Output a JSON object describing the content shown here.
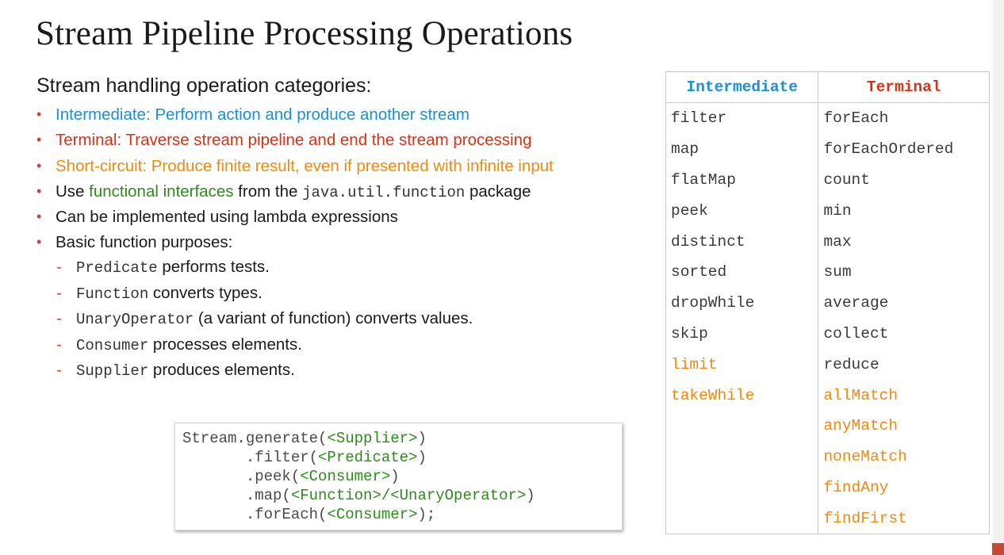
{
  "title": "Stream Pipeline Processing Operations",
  "subtitle": "Stream handling operation categories:",
  "bullets": {
    "intermediate": "Intermediate: Perform action and produce another stream",
    "terminal": "Terminal: Traverse stream pipeline and end the stream processing",
    "short_circuit": "Short-circuit: Produce finite result, even if presented with infinite input",
    "functional_prefix": "Use ",
    "functional_highlight": "functional interfaces",
    "functional_mid": " from the ",
    "functional_code": "java.util.function",
    "functional_suffix": " package",
    "lambda": "Can be implemented using lambda expressions",
    "purposes": "Basic function purposes:"
  },
  "purposes": [
    {
      "code": "Predicate",
      "text": " performs tests."
    },
    {
      "code": "Function",
      "text": " converts types."
    },
    {
      "code": "UnaryOperator",
      "text": " (a variant of function) converts values."
    },
    {
      "code": "Consumer",
      "text": " processes elements."
    },
    {
      "code": "Supplier",
      "text": " produces elements."
    }
  ],
  "code_example": {
    "l1a": "Stream.generate(",
    "l1b": "<Supplier>",
    "l1c": ")",
    "l2a": "       .filter(",
    "l2b": "<Predicate>",
    "l2c": ")",
    "l3a": "       .peek(",
    "l3b": "<Consumer>",
    "l3c": ")",
    "l4a": "       .map(",
    "l4b": "<Function>/<UnaryOperator>",
    "l4c": ")",
    "l5a": "       .forEach(",
    "l5b": "<Consumer>",
    "l5c": ");"
  },
  "table": {
    "headers": [
      "Intermediate",
      "Terminal"
    ],
    "intermediate": [
      "filter",
      "map",
      "flatMap",
      "peek",
      "distinct",
      "sorted",
      "dropWhile",
      "skip",
      "limit",
      "takeWhile"
    ],
    "terminal": [
      "forEach",
      "forEachOrdered",
      "count",
      "min",
      "max",
      "sum",
      "average",
      "collect",
      "reduce",
      "allMatch",
      "anyMatch",
      "noneMatch",
      "findAny",
      "findFirst"
    ]
  },
  "colors": {
    "intermediate": "#1b8fd8",
    "terminal": "#d43317",
    "short_circuit": "#ef8a0c",
    "functional": "#2f8a1e",
    "bullet": "#c74634"
  }
}
